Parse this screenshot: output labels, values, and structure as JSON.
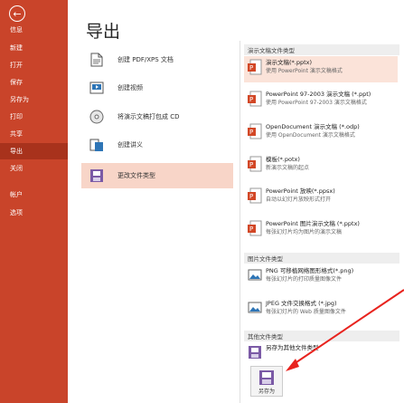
{
  "sidebar": {
    "items": [
      {
        "label": "信息"
      },
      {
        "label": "新建"
      },
      {
        "label": "打开"
      },
      {
        "label": "保存"
      },
      {
        "label": "另存为"
      },
      {
        "label": "打印"
      },
      {
        "label": "共享"
      },
      {
        "label": "导出"
      },
      {
        "label": "关闭"
      },
      {
        "label": "帐户"
      },
      {
        "label": "选项"
      }
    ],
    "active": "导出"
  },
  "page": {
    "title": "导出"
  },
  "actions": [
    {
      "label": "创建 PDF/XPS 文档"
    },
    {
      "label": "创建视频"
    },
    {
      "label": "将演示文稿打包成 CD"
    },
    {
      "label": "创建讲义"
    },
    {
      "label": "更改文件类型"
    }
  ],
  "sections": {
    "presentation": "演示文稿文件类型",
    "image": "图片文件类型",
    "other": "其他文件类型"
  },
  "file_types": [
    {
      "title": "演示文稿(*.pptx)",
      "desc": "使用 PowerPoint 演示文稿格式"
    },
    {
      "title": "PowerPoint 97-2003 演示文稿 (*.ppt)",
      "desc": "使用 PowerPoint 97-2003 演示文稿格式"
    },
    {
      "title": "OpenDocument 演示文稿 (*.odp)",
      "desc": "使用 OpenDocument 演示文稿格式"
    },
    {
      "title": "模板(*.potx)",
      "desc": "新演示文稿的起点"
    },
    {
      "title": "PowerPoint 放映(*.ppsx)",
      "desc": "自动以幻灯片放映形式打开"
    },
    {
      "title": "PowerPoint 图片演示文稿 (*.pptx)",
      "desc": "每张幻灯片均为图片的演示文稿"
    },
    {
      "title": "PNG 可移植网络图形格式(*.png)",
      "desc": "每张幻灯片的打印质量图像文件"
    },
    {
      "title": "JPEG 文件交换格式 (*.jpg)",
      "desc": "每张幻灯片的 Web 质量图像文件"
    },
    {
      "title": "另存为其他文件类型",
      "desc": ""
    }
  ],
  "save_button": {
    "label": "另存为"
  },
  "colors": {
    "sidebar": "#c9442a",
    "active": "#a8321c",
    "highlight": "#f8d5c8",
    "arrow": "#e8231e"
  }
}
